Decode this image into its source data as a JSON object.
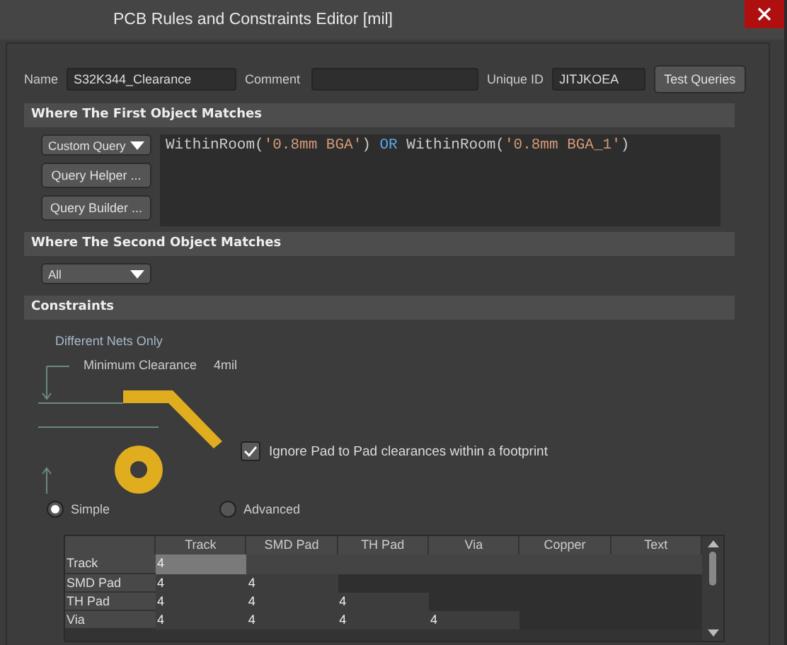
{
  "window": {
    "title": "PCB Rules and Constraints Editor [mil]"
  },
  "header": {
    "name_label": "Name",
    "name_value": "S32K344_Clearance",
    "comment_label": "Comment",
    "unique_id_label": "Unique ID",
    "unique_id_value": "JITJKOEA",
    "test_button": "Test Queries"
  },
  "first_object": {
    "title": "Where The First Object Matches",
    "query_type": "Custom Query",
    "buttons": [
      "Query Helper ...",
      "Query Builder ..."
    ],
    "query": [
      {
        "kind": "code",
        "text": "WithinRoom("
      },
      {
        "kind": "string",
        "text": "'0.8mm BGA'"
      },
      {
        "kind": "code",
        "text": ") "
      },
      {
        "kind": "keyword",
        "text": "OR"
      },
      {
        "kind": "code",
        "text": " WithinRoom("
      },
      {
        "kind": "string",
        "text": "'0.8mm BGA_1'"
      },
      {
        "kind": "code",
        "text": ")"
      }
    ]
  },
  "second_object": {
    "title": "Where The Second Object Matches",
    "query_type": "All"
  },
  "constraints": {
    "title": "Constraints",
    "net_scope": "Different Nets Only",
    "clearance_label": "Minimum Clearance",
    "clearance_value": "4mil",
    "ignore_pad_to_pad": {
      "label": "Ignore Pad to Pad clearances within a footprint",
      "checked": true
    },
    "modes": [
      {
        "label": "Simple",
        "selected": true
      },
      {
        "label": "Advanced",
        "selected": false
      }
    ],
    "table": {
      "columns": [
        "Track",
        "SMD Pad",
        "TH Pad",
        "Via",
        "Copper",
        "Text"
      ],
      "rows": [
        {
          "label": "Track",
          "cells": [
            {
              "value": "4",
              "selected": true
            }
          ]
        },
        {
          "label": "SMD Pad",
          "cells": [
            {
              "value": "4",
              "selected": false
            },
            {
              "value": "4",
              "selected": false
            }
          ]
        },
        {
          "label": "TH Pad",
          "cells": [
            {
              "value": "4",
              "selected": false
            },
            {
              "value": "4",
              "selected": false
            },
            {
              "value": "4",
              "selected": false
            }
          ]
        },
        {
          "label": "Via",
          "cells": [
            {
              "value": "4",
              "selected": false
            },
            {
              "value": "4",
              "selected": false
            },
            {
              "value": "4",
              "selected": false
            },
            {
              "value": "4",
              "selected": false
            }
          ]
        }
      ]
    }
  }
}
